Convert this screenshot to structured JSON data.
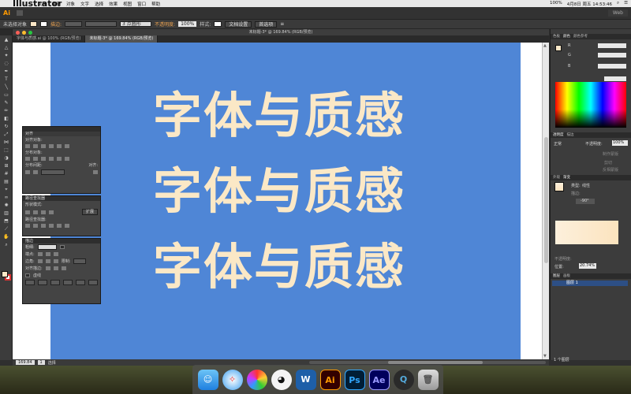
{
  "menubar": {
    "app_name": "Illustrator",
    "menus": [
      "文件",
      "编辑",
      "对象",
      "文字",
      "选择",
      "效果",
      "视图",
      "窗口",
      "帮助"
    ],
    "status_right": "100%",
    "clock": "4月8日 周五 14:53:46"
  },
  "aibar": {
    "logo": "Ai",
    "workspace": "Web"
  },
  "control": {
    "selection_label": "未选择对象",
    "stroke_label": "描边:",
    "stroke_preset": "3 点圆形",
    "opacity_label": "不透明度:",
    "opacity_value": "100%",
    "style_label": "样式:",
    "doc_setup_button": "文档设置",
    "prefs_button": "首选项"
  },
  "document": {
    "window_title": "未标题-3* @ 169.84% (RGB/预览)",
    "tabs": [
      "字体与质感.ai @ 100% (RGB/预览)",
      "未标题-3* @ 169.84% (RGB/预览)"
    ],
    "active_tab": 1,
    "artboard_lines": [
      "字体与质感",
      "字体与质感",
      "字体与质感"
    ],
    "zoom": "169.84",
    "artboard_number": "1",
    "status_tool": "选择"
  },
  "align_panel": {
    "title": "对齐",
    "align_objects": "对齐对象:",
    "distribute_objects": "分布对象:",
    "distribute_spacing": "分布间距:",
    "align_to": "对齐:"
  },
  "pathfinder_panel": {
    "title": "路径查找器",
    "shape_modes": "形状模式:",
    "pathfinders": "路径查找器:",
    "expand_button": "扩展"
  },
  "stroke_panel": {
    "title": "描边",
    "weight": "粗细:",
    "cap": "端点:",
    "corner": "边角:",
    "limit": "限制:",
    "align_stroke": "对齐描边:",
    "dashed": "虚线"
  },
  "right_dock": {
    "color_tabs": [
      "色板",
      "颜色",
      "颜色参考"
    ],
    "channels": [
      "R",
      "G",
      "B"
    ],
    "transparency_tabs": [
      "透明度",
      "描边"
    ],
    "blend_mode": "正常",
    "opacity_label": "不透明度:",
    "opacity_value": "100%",
    "mask_button": "制作蒙版",
    "clip": "剪切",
    "invert_mask": "反相蒙版",
    "gradient_tabs": [
      "外观",
      "渐变"
    ],
    "gradient_type_label": "类型:",
    "gradient_type": "线性",
    "stroke_label": "描边:",
    "angle": "-90°",
    "location_label": "位置:",
    "location": "20.74%",
    "opacity_label2": "不透明度:",
    "layers_tabs": [
      "图层",
      "画板"
    ],
    "layer_name": "图层 1",
    "layers_count": "1 个图层"
  },
  "mac_dock": {
    "apps": [
      "Finder",
      "Safari",
      "Photos",
      "QQ",
      "W",
      "Ai",
      "Ps",
      "Ae",
      "Q",
      "Trash"
    ]
  }
}
